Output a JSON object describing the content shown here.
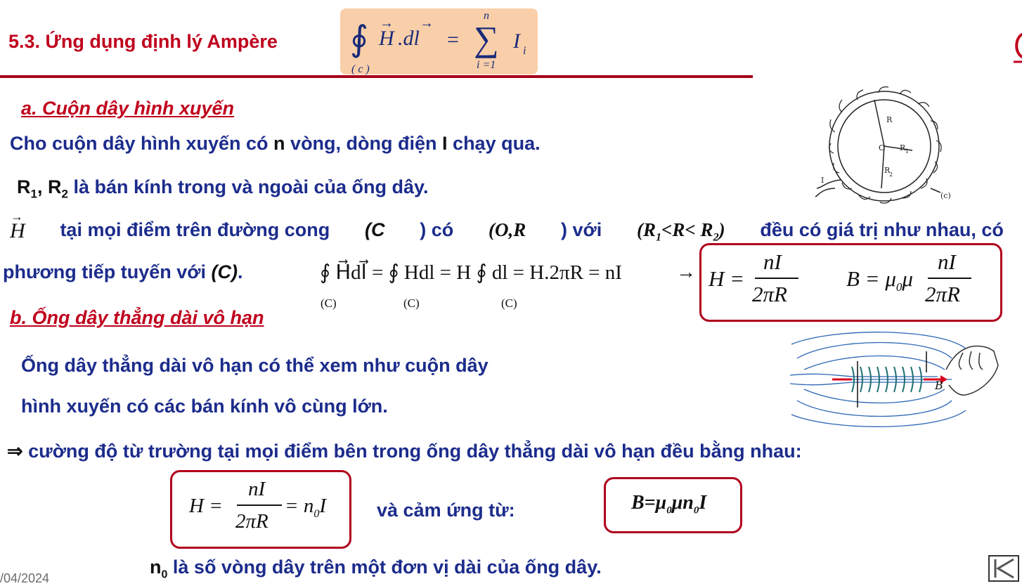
{
  "header": {
    "title": "5.3. Ứng dụng định lý Ampère",
    "formula": {
      "lhs_H": "H",
      "lhs_dl": ".dl",
      "equals": "=",
      "sum_upper": "n",
      "sum_lower": "i =1",
      "rhs": "I",
      "rhs_sub": "i",
      "contour": "( c )"
    }
  },
  "section_a": {
    "heading": "a. Cuộn dây hình xuyến",
    "line1_pre": "Cho cuộn dây hình xuyến có ",
    "line1_n": "n",
    "line1_mid": " vòng, dòng điện ",
    "line1_I": "I",
    "line1_post": " chạy qua.",
    "line2_R1": "R",
    "line2_sub1": "1",
    "line2_comma": ", R",
    "line2_sub2": "2",
    "line2_post": " là bán kính trong và ngoài của ống dây.",
    "line3_H": "H",
    "line3_t1": " tại mọi điểm trên đường cong ",
    "line3_C": "(C",
    "line3_t2": ") có ",
    "line3_OR": "(O,R",
    "line3_t3": ") với ",
    "line3_R1": "(R",
    "line3_s1": "1",
    "line3_lt": "<R< R",
    "line3_s2": "2",
    "line3_close": ")",
    "line3_t4": " đều có giá trị như nhau, có",
    "line4_pre": "phương tiếp tuyến với ",
    "line4_C": "(C)",
    "line4_post": ".",
    "derivation": "∮ H⃗dl⃗ = ∮ Hdl = H ∮ dl = H.2πR = nI",
    "derivation_sub": "(C)",
    "arrow": "→",
    "result_H_lhs": "H =",
    "result_num": "nI",
    "result_den": "2πR",
    "result_B_lhs": "B = μ",
    "result_B_sub": "0",
    "result_B_mu": "μ"
  },
  "section_b": {
    "heading": "b. Ống dây thẳng dài vô hạn",
    "line1": "Ống dây thẳng dài vô hạn có thể xem như cuộn dây",
    "line2": "hình xuyến có các bán kính vô cùng lớn.",
    "implies_symbol": "⇒",
    "line3": " cường độ từ trường tại mọi điểm bên trong ống dây thẳng dài vô hạn đều bằng nhau:",
    "box1_lhs": "H =",
    "box1_num": "nI",
    "box1_den": "2πR",
    "box1_rhs": "= n",
    "box1_rhs_sub": "0",
    "box1_rhs_I": "I",
    "and_text": "và cảm ứng từ:",
    "box2_B": "B=μ",
    "box2_sub0": "0",
    "box2_mu": "μn",
    "box2_sub1": "0",
    "box2_I": "I",
    "n0_n": "n",
    "n0_sub": "0",
    "n0_text": " là số vòng dây trên một đơn vị dài của ống dây."
  },
  "figures": {
    "toroid_labels": [
      "R",
      "O",
      "R",
      "1",
      "R",
      "2",
      "(c)",
      "I"
    ],
    "solenoid_label": "B"
  },
  "footer": {
    "date": "/04/2024"
  },
  "colors": {
    "title_red": "#c0001c",
    "text_blue": "#1c2c8c",
    "formula_box_fill": "#f9cfa9",
    "rule": "#a6001a"
  },
  "icons": [
    "logo-icon",
    "first-slide-nav-icon"
  ]
}
